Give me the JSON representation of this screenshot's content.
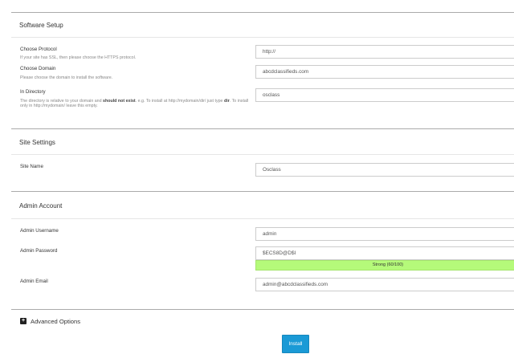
{
  "software_setup": {
    "title": "Software Setup",
    "protocol_label": "Choose Protocol",
    "protocol_hint": "If your site has SSL, then please choose the HTTPS protocol.",
    "protocol_value": "http://",
    "domain_label": "Choose Domain",
    "domain_hint": "Please choose the domain to install the software.",
    "domain_value": "abcdclassifieds.com",
    "directory_label": "In Directory",
    "directory_hint_1": "The directory is relative to your domain and ",
    "directory_hint_bold": "should not exist",
    "directory_hint_2": ". e.g. To install at http://mydomain/dir/ just type ",
    "directory_hint_dir": "dir",
    "directory_hint_3": ". To install only in http://mydomain/ leave this empty.",
    "directory_value": "osclass"
  },
  "site_settings": {
    "title": "Site Settings",
    "site_name_label": "Site Name",
    "site_name_value": "Osclass"
  },
  "admin_account": {
    "title": "Admin Account",
    "username_label": "Admin Username",
    "username_value": "admin",
    "password_label": "Admin Password",
    "password_value": "$ECS8D@D$I",
    "strength_text": "Strong (60/100)",
    "strength_fraction": 0.6,
    "email_label": "Admin Email",
    "email_value": "admin@abcdclassifieds.com"
  },
  "advanced": {
    "label": "Advanced Options",
    "icon": "plus-square-icon"
  },
  "install_label": "Install",
  "colors": {
    "accent": "#1a9ad6",
    "strength_bar": "#b5fa7a"
  }
}
